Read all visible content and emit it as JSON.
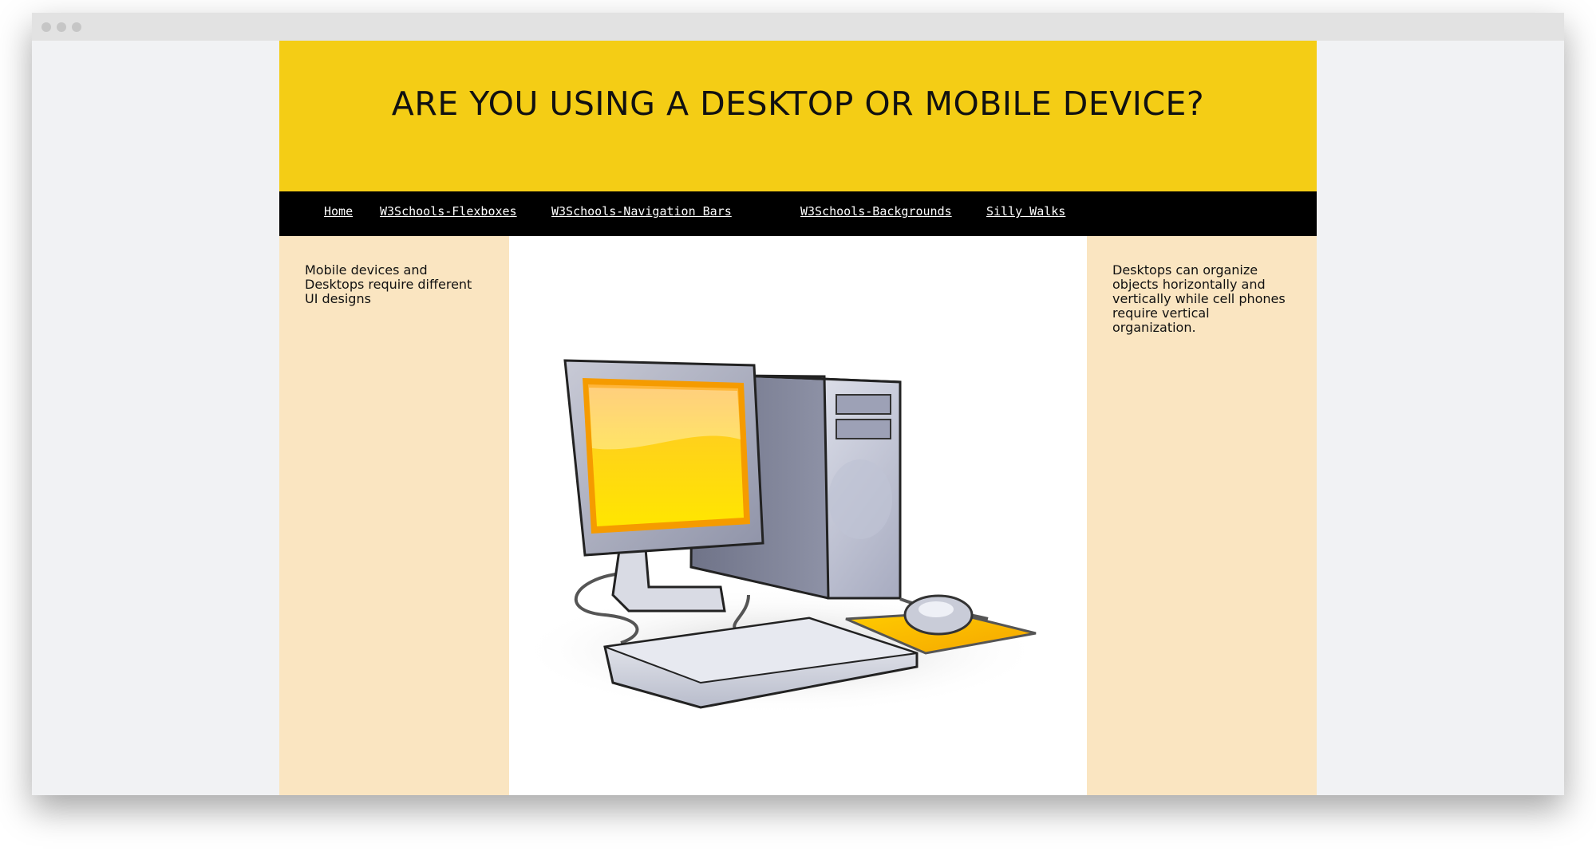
{
  "page": {
    "title": "ARE YOU USING A DESKTOP OR MOBILE DEVICE?"
  },
  "nav": {
    "links": [
      "Home",
      "W3Schools-Flexboxes",
      "W3Schools-Navigation Bars",
      "W3Schools-Backgrounds",
      "Silly Walks"
    ]
  },
  "left_panel": {
    "text": "Mobile devices and Desktops require different UI designs"
  },
  "right_panel": {
    "text": "Desktops can organize objects horizontally and vertically while cell phones require vertical organization."
  },
  "main": {
    "image_icon": "desktop-computer-icon"
  },
  "colors": {
    "header_bg": "#f4cd15",
    "nav_bg": "#000000",
    "side_bg": "#fae5c1",
    "monitor_screen": "#ffd700"
  }
}
